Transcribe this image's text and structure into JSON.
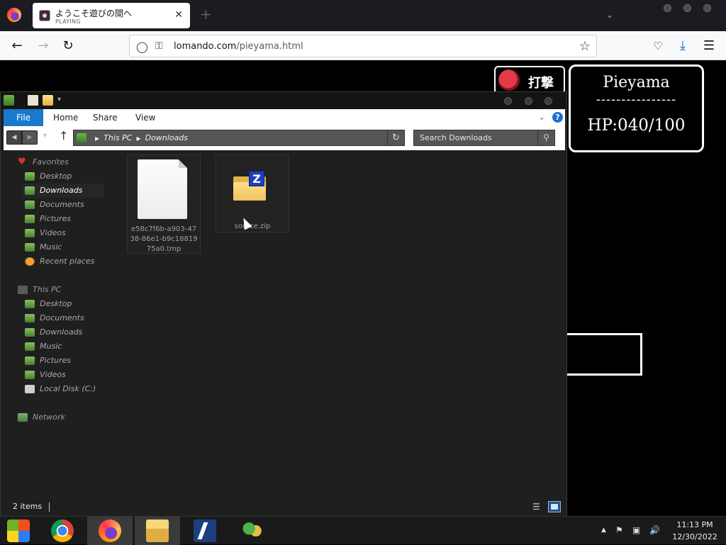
{
  "browser": {
    "tab": {
      "title": "ようこそ遊びの間へ",
      "subtitle": "PLAYING",
      "close": "✕"
    },
    "new_tab": "+",
    "url": {
      "host": "lomando.com",
      "path": "/pieyama.html"
    }
  },
  "game": {
    "attack_label": "打撃",
    "status": {
      "name": "Pieyama",
      "separator": "----------------",
      "hp": "HP:040/100"
    }
  },
  "explorer": {
    "ribbon": {
      "file": "File",
      "tabs": [
        "Home",
        "Share",
        "View"
      ],
      "help": "?"
    },
    "address": {
      "crumbs": [
        "This PC",
        "Downloads"
      ]
    },
    "search_placeholder": "Search Downloads",
    "nav": {
      "favorites": {
        "label": "Favorites",
        "items": [
          "Desktop",
          "Downloads",
          "Documents",
          "Pictures",
          "Videos",
          "Music",
          "Recent places"
        ]
      },
      "this_pc": {
        "label": "This PC",
        "items": [
          "Desktop",
          "Documents",
          "Downloads",
          "Music",
          "Pictures",
          "Videos",
          "Local Disk (C:)"
        ]
      },
      "network": {
        "label": "Network"
      }
    },
    "files": [
      {
        "name": "e58c7f6b-a903-4738-86e1-b9c1881975a0.tmp",
        "type": "tmp"
      },
      {
        "name": "source.zip",
        "type": "zip"
      }
    ],
    "status": {
      "count": "2 items"
    }
  },
  "taskbar": {
    "clock": {
      "time": "11:13 PM",
      "date": "12/30/2022"
    }
  },
  "colors": {
    "ribbon_file": "#1979ca",
    "explorer_bg": "#1f1f1f",
    "page_bg": "#000000"
  }
}
